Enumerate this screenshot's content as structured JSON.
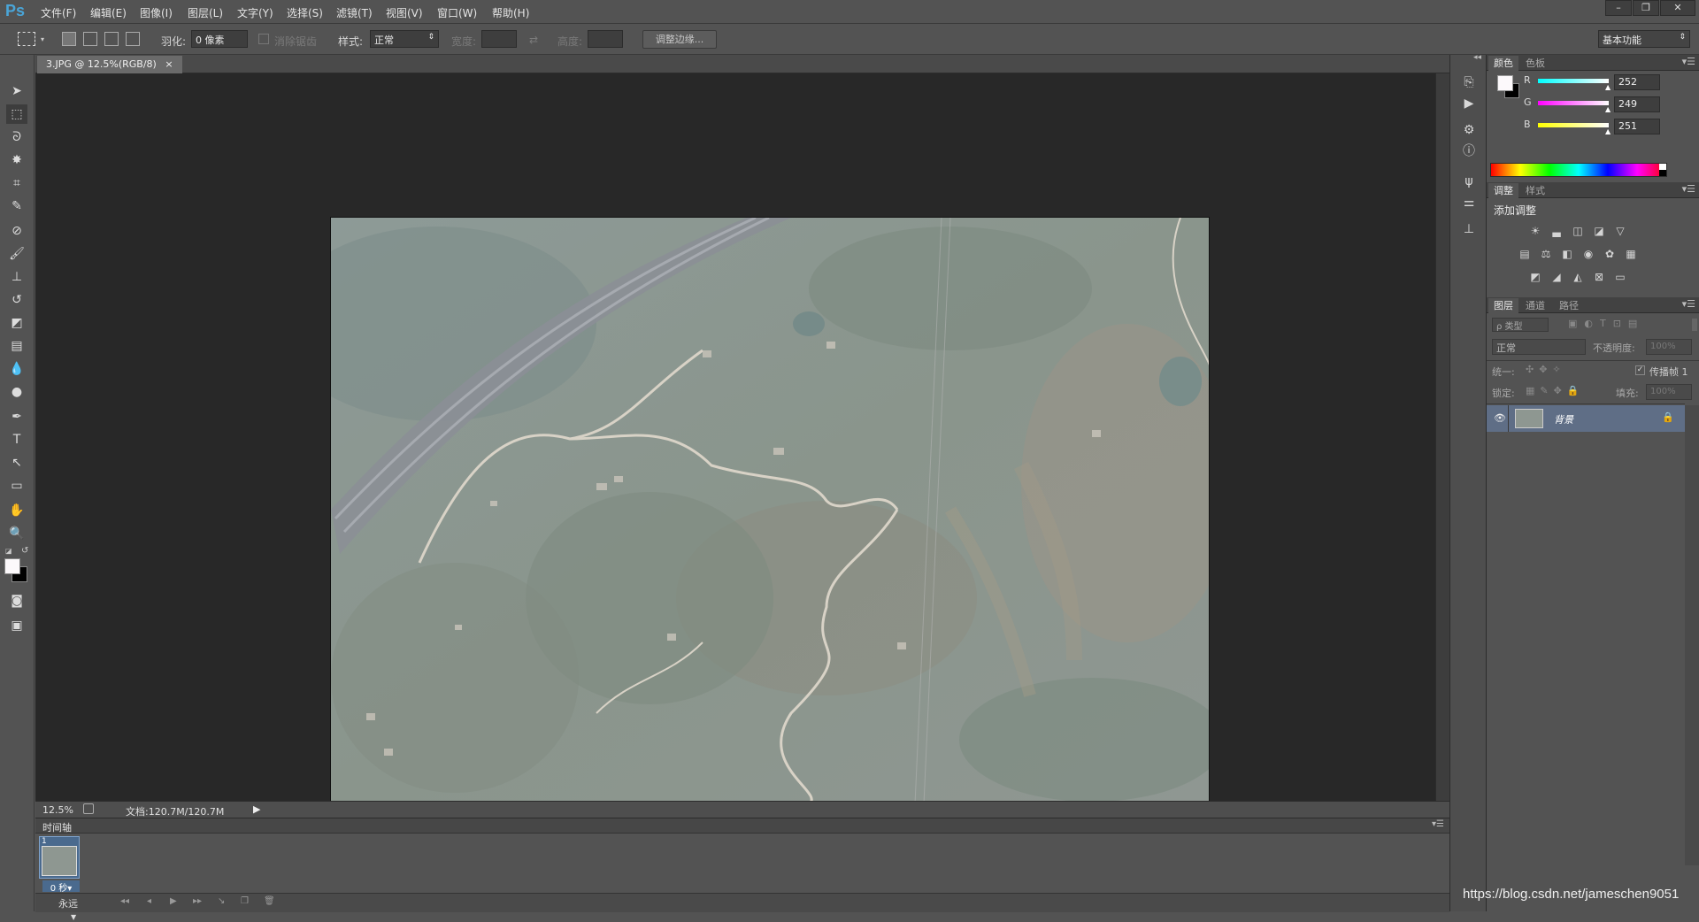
{
  "app": {
    "logo": "Ps"
  },
  "menu": [
    "文件(F)",
    "编辑(E)",
    "图像(I)",
    "图层(L)",
    "文字(Y)",
    "选择(S)",
    "滤镜(T)",
    "视图(V)",
    "窗口(W)",
    "帮助(H)"
  ],
  "window_controls": {
    "minimize": "–",
    "restore": "❐",
    "close": "✕"
  },
  "options": {
    "feather_label": "羽化:",
    "feather_value": "0 像素",
    "antialias_label": "消除锯齿",
    "style_label": "样式:",
    "style_value": "正常",
    "width_label": "宽度:",
    "height_label": "高度:",
    "refine_edge_button": "调整边缘...",
    "workspace": "基本功能"
  },
  "document": {
    "tab_title": "3.JPG @ 12.5%(RGB/8)",
    "tab_close": "×"
  },
  "status": {
    "zoom": "12.5%",
    "doc_info": "文档:120.7M/120.7M"
  },
  "timeline": {
    "title": "时间轴",
    "frame_number": "1",
    "frame_delay": "0 秒▾",
    "loop": "永远"
  },
  "color_panel": {
    "tabs": [
      "颜色",
      "色板"
    ],
    "channels": [
      {
        "label": "R",
        "value": "252",
        "color": "#00e5ff"
      },
      {
        "label": "G",
        "value": "249",
        "color": "#ff00ff"
      },
      {
        "label": "B",
        "value": "251",
        "color": "#ffff00"
      }
    ]
  },
  "adjustments_panel": {
    "tabs": [
      "调整",
      "样式"
    ],
    "title": "添加调整"
  },
  "layers_panel": {
    "tabs": [
      "图层",
      "通道",
      "路径"
    ],
    "filter_label": "ρ 类型",
    "blend_mode": "正常",
    "opacity_label": "不透明度:",
    "opacity_value": "100%",
    "unify_label": "统一:",
    "propagate_label": "传播帧 1",
    "lock_label": "锁定:",
    "fill_label": "填充:",
    "fill_value": "100%",
    "layers": [
      {
        "name": "背景",
        "visible": true,
        "locked": true
      }
    ]
  },
  "watermark": "https://blog.csdn.net/jameschen9051"
}
